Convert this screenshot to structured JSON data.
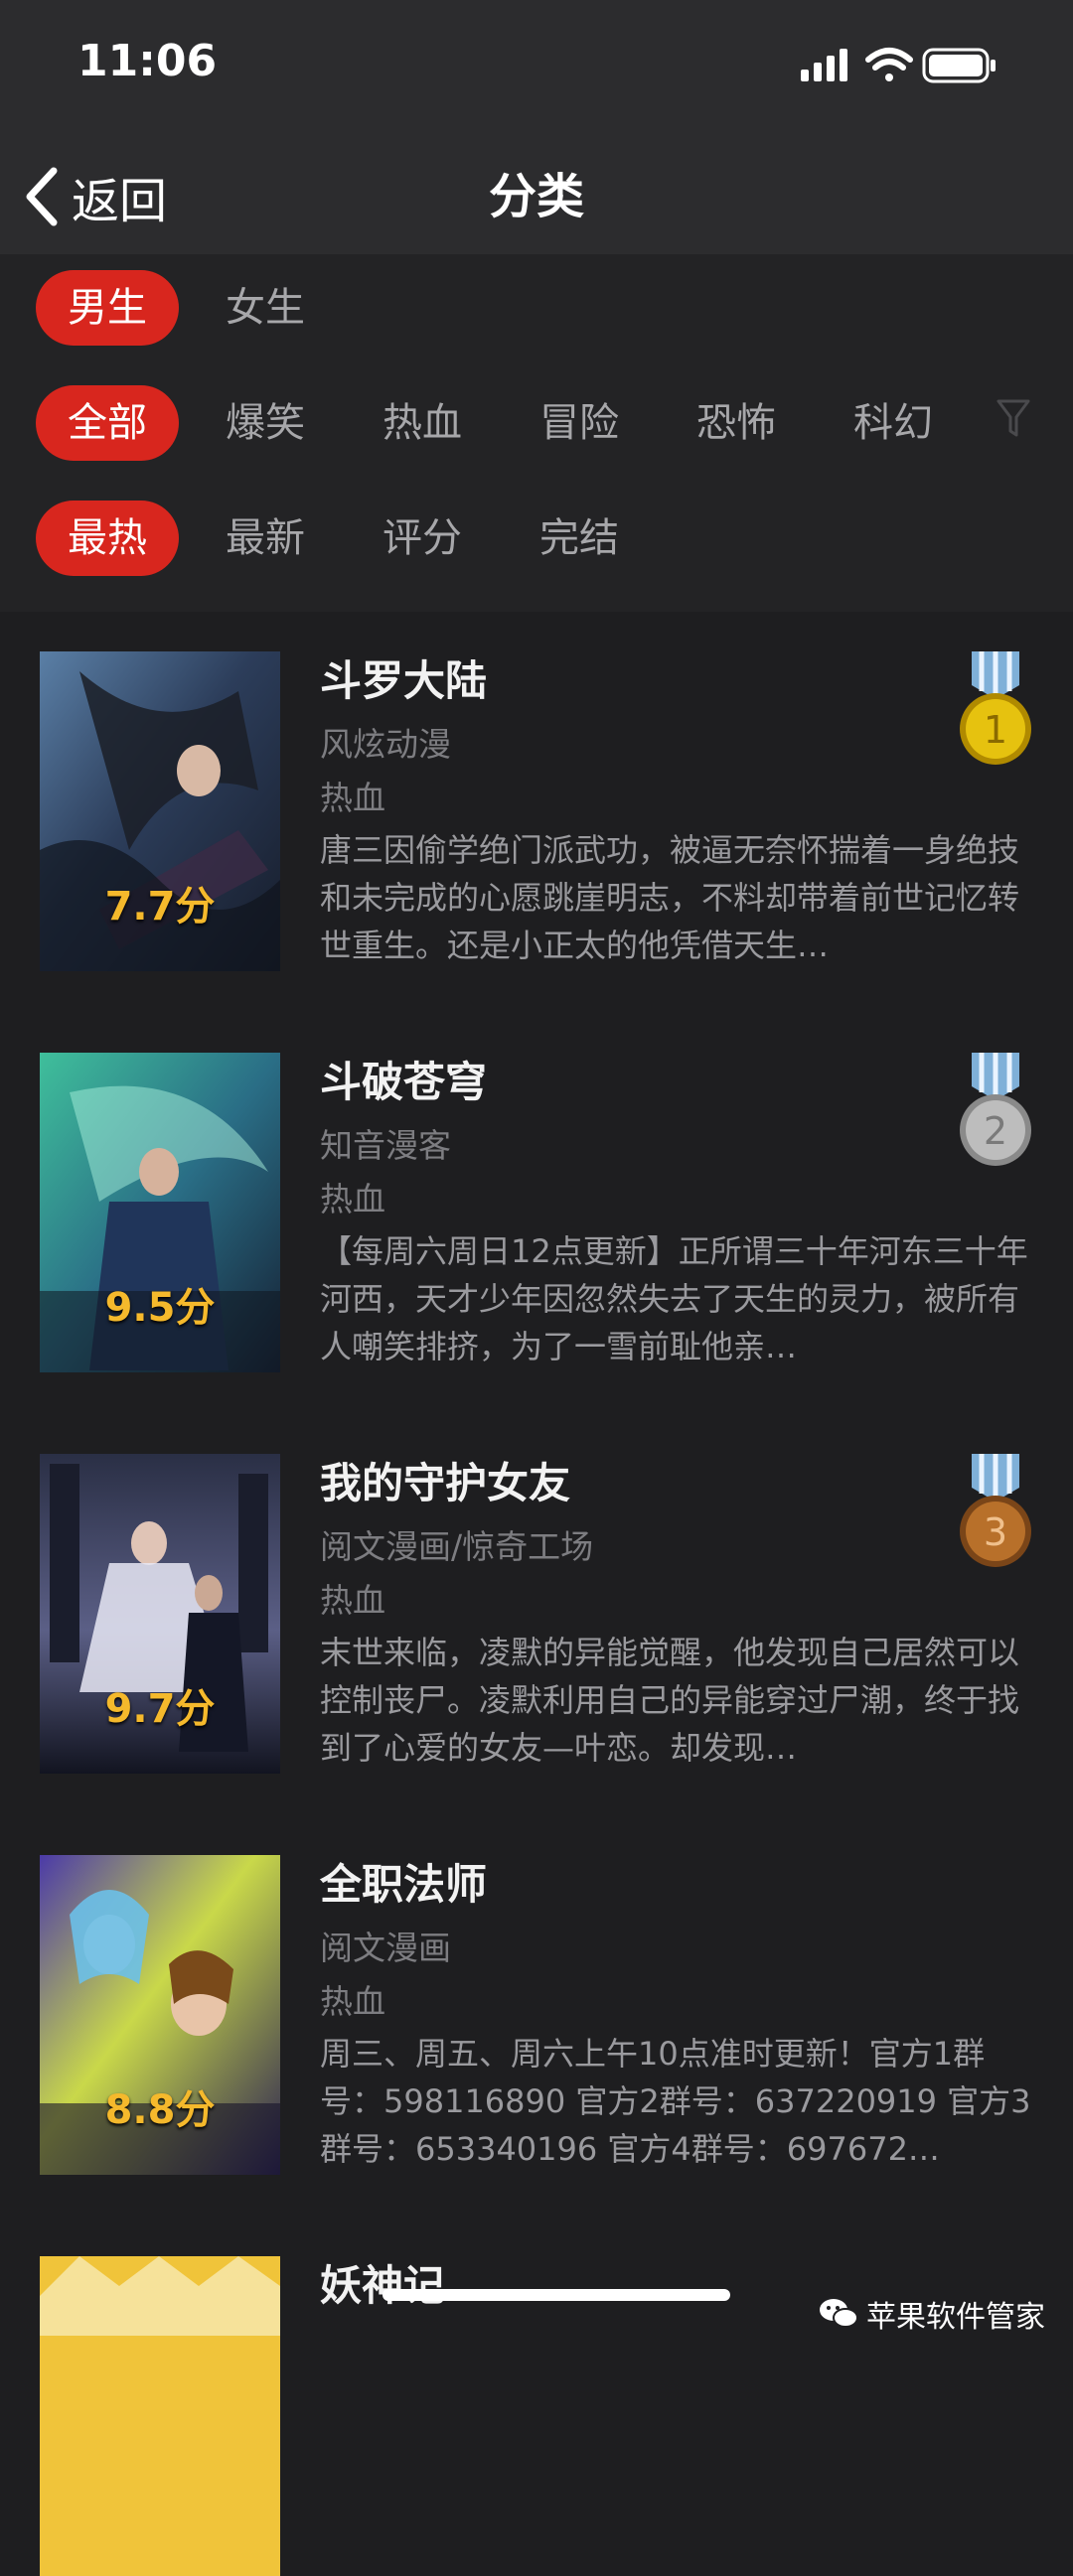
{
  "status": {
    "time": "11:06"
  },
  "nav": {
    "back_label": "返回",
    "title": "分类"
  },
  "filters": {
    "gender": [
      "男生",
      "女生"
    ],
    "genre": [
      "全部",
      "爆笑",
      "热血",
      "冒险",
      "恐怖",
      "科幻"
    ],
    "sort": [
      "最热",
      "最新",
      "评分",
      "完结"
    ]
  },
  "comics": [
    {
      "title": "斗罗大陆",
      "author": "风炫动漫",
      "tag": "热血",
      "score": "7.7分",
      "desc": "唐三因偷学绝门派武功，被逼无奈怀揣着一身绝技和未完成的心愿跳崖明志，不料却带着前世记忆转世重生。还是小正太的他凭借天生…",
      "medal": "1",
      "medal_color": "#e6c20f"
    },
    {
      "title": "斗破苍穹",
      "author": "知音漫客",
      "tag": "热血",
      "score": "9.5分",
      "desc": "【每周六周日12点更新】正所谓三十年河东三十年河西，天才少年因忽然失去了天生的灵力，被所有人嘲笑排挤，为了一雪前耻他亲…",
      "medal": "2",
      "medal_color": "#bdbdbd"
    },
    {
      "title": "我的守护女友",
      "author": "阅文漫画/惊奇工场",
      "tag": "热血",
      "score": "9.7分",
      "desc": "末世来临，凌默的异能觉醒，他发现自己居然可以控制丧尸。凌默利用自己的异能穿过尸潮，终于找到了心爱的女友—叶恋。却发现…",
      "medal": "3",
      "medal_color": "#b8702a"
    },
    {
      "title": "全职法师",
      "author": "阅文漫画",
      "tag": "热血",
      "score": "8.8分",
      "desc": "周三、周五、周六上午10点准时更新！官方1群号：598116890 官方2群号：637220919 官方3群号：653340196 官方4群号：697672…"
    },
    {
      "title": "妖神记"
    }
  ],
  "watermark": "苹果软件管家",
  "colors": {
    "accent": "#d8261e",
    "background": "#1e1e20",
    "score": "#f5b92c"
  }
}
